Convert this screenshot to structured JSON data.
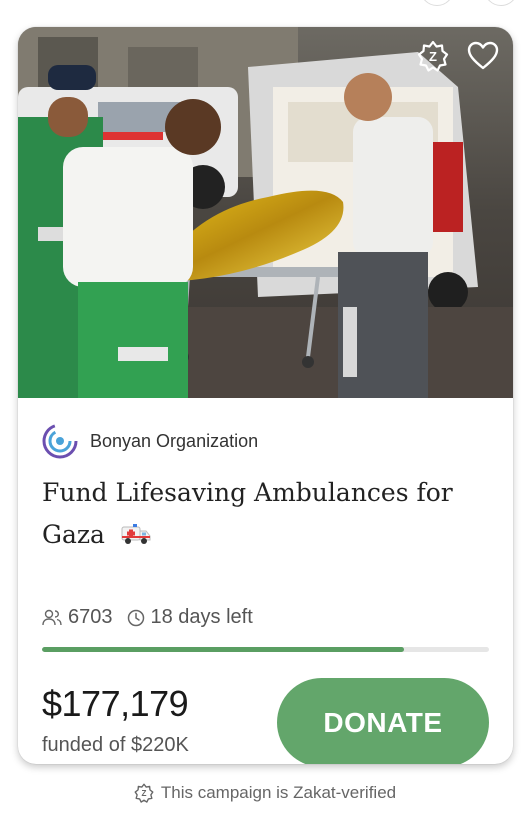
{
  "campaign": {
    "organization": "Bonyan Organization",
    "title": "Fund Lifesaving Ambulances for Gaza",
    "title_emoji": "ambulance-icon",
    "donors": "6703",
    "time_left": "18 days left",
    "progress_fraction": 0.81,
    "amount_raised": "$177,179",
    "goal_text": "funded of $220K",
    "donate_label": "DONATE"
  },
  "footer": {
    "zakat_text": "This campaign is Zakat-verified"
  },
  "colors": {
    "accent": "#63a66b",
    "progress": "#5a9e62",
    "org_logo": "#6b4fb0"
  },
  "icons": [
    "zakat-badge-icon",
    "heart-icon",
    "org-logo",
    "people-icon",
    "clock-icon",
    "ambulance-icon",
    "zakat-verified-icon"
  ]
}
